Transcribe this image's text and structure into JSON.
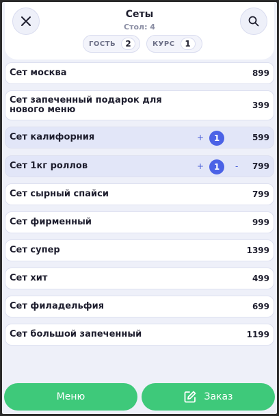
{
  "header": {
    "title": "Сеты",
    "subtitle": "Стол: 4",
    "close_icon": "close-icon",
    "search_icon": "search-icon",
    "guest": {
      "label": "ГОСТЬ",
      "value": "2"
    },
    "course": {
      "label": "КУРС",
      "value": "1"
    }
  },
  "items": [
    {
      "name": "Сет москва",
      "price": "899"
    },
    {
      "name": "Сет запеченный подарок для нового меню",
      "price": "399"
    },
    {
      "name": "Сет калифорния",
      "price": "599",
      "plus": "+",
      "qty": "1"
    },
    {
      "name": "Сет 1кг роллов",
      "price": "799",
      "plus": "+",
      "qty": "1",
      "minus": "-"
    },
    {
      "name": "Сет сырный спайси",
      "price": "799"
    },
    {
      "name": "Сет фирменный",
      "price": "999"
    },
    {
      "name": "Сет супер",
      "price": "1399"
    },
    {
      "name": "Сет хит",
      "price": "499"
    },
    {
      "name": "Сет филадельфия",
      "price": "699"
    },
    {
      "name": "Сет большой запеченный",
      "price": "1199"
    }
  ],
  "footer": {
    "menu_label": "Меню",
    "order_label": "Заказ",
    "order_icon": "edit-icon"
  },
  "colors": {
    "accent_green": "#3ec97a",
    "qty_badge": "#4b62e6",
    "selected_row": "#e2e6f8",
    "background": "#eef0f9"
  }
}
